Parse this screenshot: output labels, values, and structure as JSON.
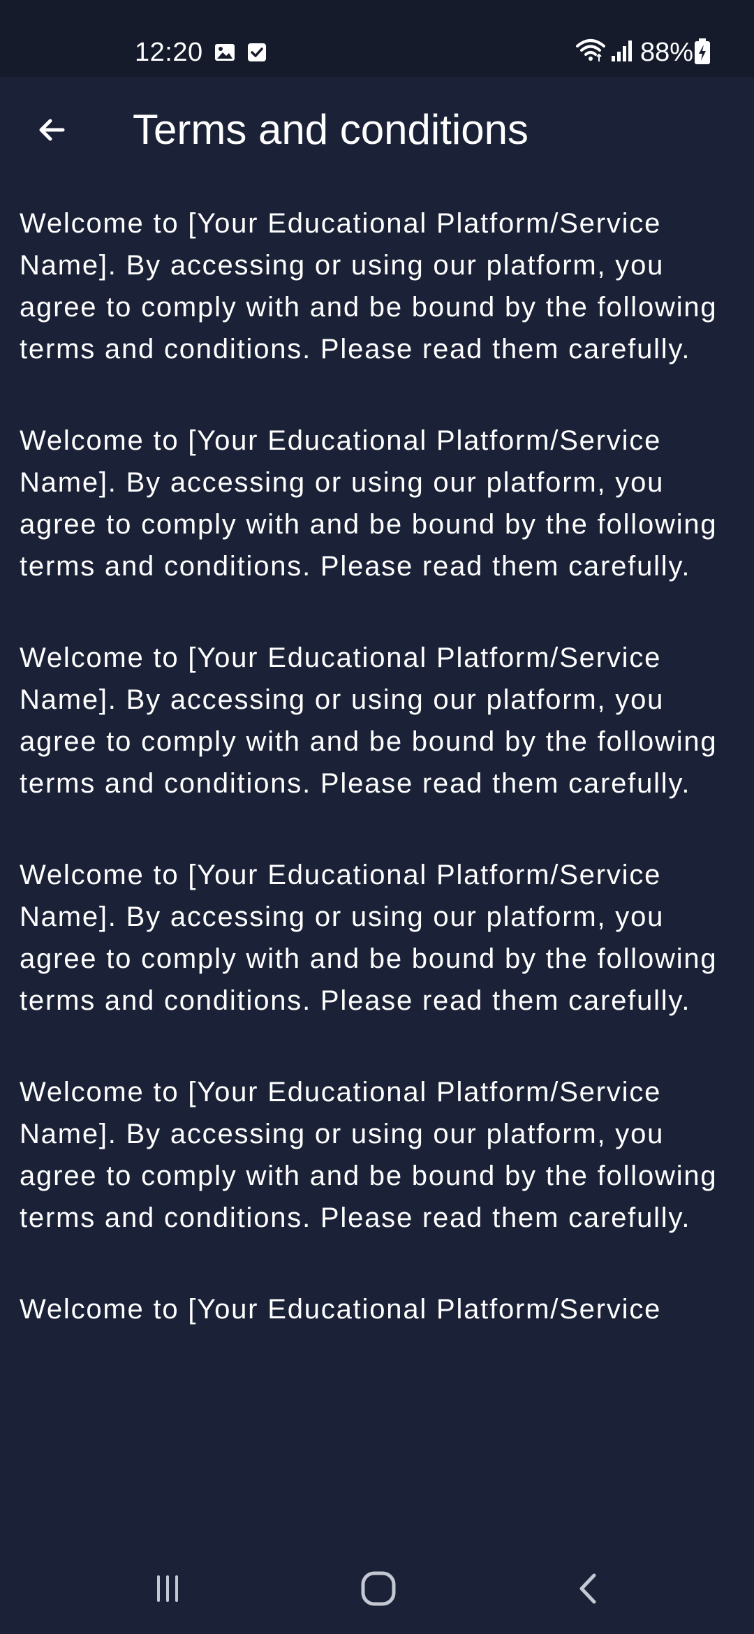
{
  "status_bar": {
    "time": "12:20",
    "battery_percent": "88%",
    "icons": [
      "gallery-icon",
      "checkbox-icon",
      "wifi-icon",
      "signal-icon",
      "battery-charging-icon"
    ]
  },
  "app_bar": {
    "back_icon": "arrow-left-icon",
    "title": "Terms and conditions"
  },
  "content": {
    "paragraphs": [
      "Welcome to [Your Educational Platform/Service Name]. By accessing or using our platform, you agree to comply with and be bound by the following terms and conditions. Please read them carefully.",
      "Welcome to [Your Educational Platform/Service Name]. By accessing or using our platform, you agree to comply with and be bound by the following terms and conditions. Please read them carefully.",
      "Welcome to [Your Educational Platform/Service Name]. By accessing or using our platform, you agree to comply with and be bound by the following terms and conditions. Please read them carefully.",
      "Welcome to [Your Educational Platform/Service Name]. By accessing or using our platform, you agree to comply with and be bound by the following terms and conditions. Please read them carefully.",
      "Welcome to [Your Educational Platform/Service Name]. By accessing or using our platform, you agree to comply with and be bound by the following terms and conditions. Please read them carefully.",
      "Welcome to [Your Educational Platform/Service"
    ]
  },
  "nav_bar": {
    "icons": [
      "recent-apps-icon",
      "home-icon",
      "back-icon"
    ]
  },
  "colors": {
    "background": "#1b2237",
    "status_bar": "#151b2b",
    "text": "#ffffff",
    "nav_icon": "#c4c8d2"
  }
}
